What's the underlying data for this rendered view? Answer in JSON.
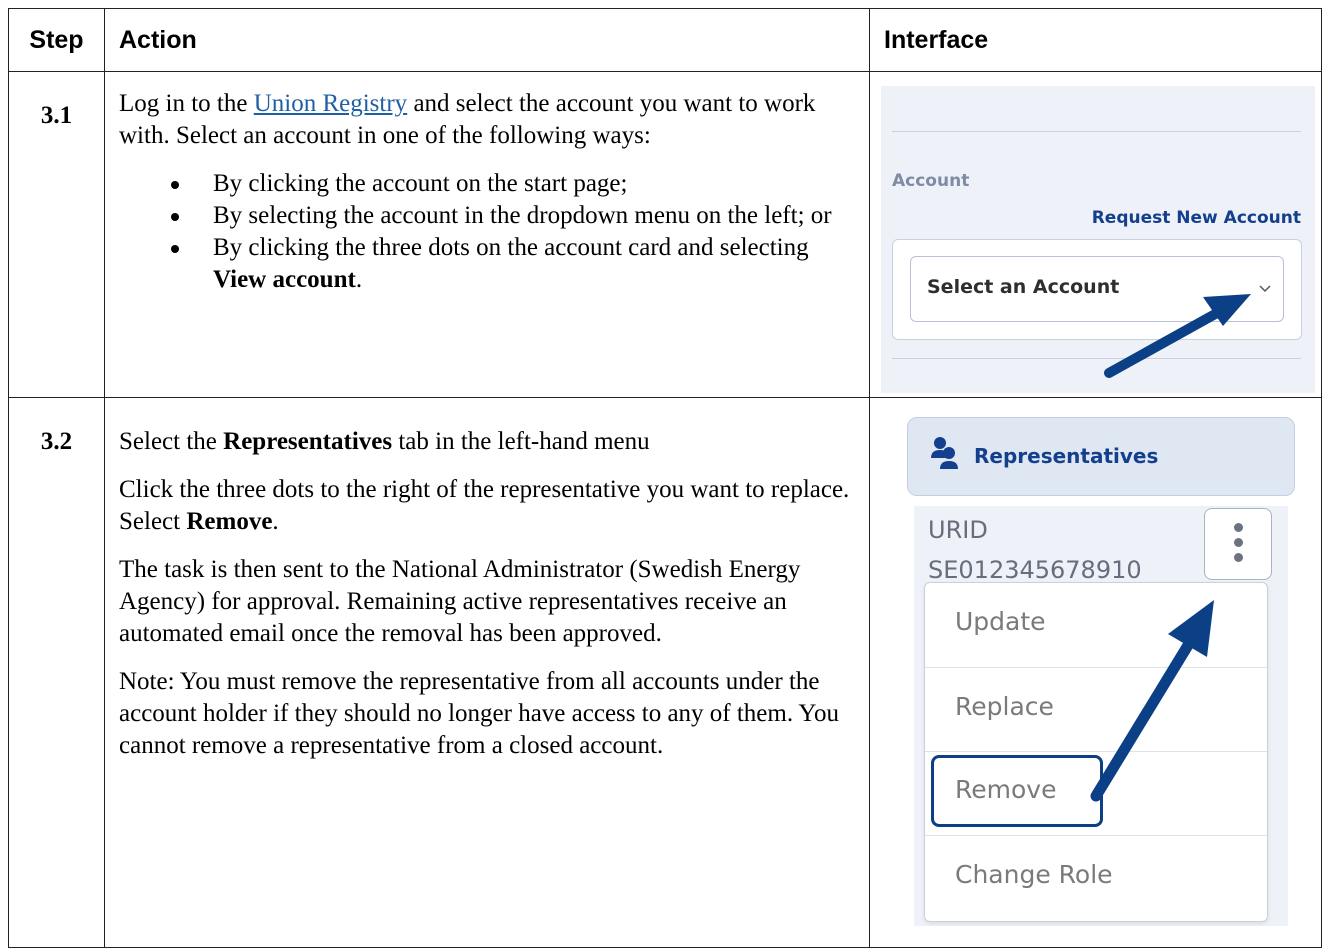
{
  "headers": {
    "step": "Step",
    "action": "Action",
    "interface": "Interface"
  },
  "rows": [
    {
      "step": "3.1",
      "intro_1": "Log in to the ",
      "link": "Union Registry",
      "intro_2": " and select the account you want to work with. Select an account in one of the following ways:",
      "bullets": [
        "By clicking the account on the start page;",
        "By selecting the account in the dropdown menu on the left; or"
      ],
      "bullet3_pre": "By clicking the three dots on the account card and selecting ",
      "bullet3_bold": "View account",
      "bullet3_post": "."
    },
    {
      "step": "3.2",
      "p1_pre": "Select the ",
      "p1_bold": "Representatives",
      "p1_post": " tab in the left-hand menu",
      "p2_pre": "Click the three dots to the right of the representative you want to replace. Select ",
      "p2_bold": "Remove",
      "p2_post": ".",
      "p3": "The task is then sent to the National Administrator (Swedish Energy Agency) for approval. Remaining active representatives receive an automated email once the removal has been approved.",
      "p4": "Note: You must remove the representative from all accounts under the account holder if they should no longer have access to any of them. You cannot remove a representative from a closed account."
    }
  ],
  "panel1": {
    "account_label": "Account",
    "request_link": "Request New Account",
    "select_placeholder": "Select an Account",
    "chevron_icon": "chevron-down-icon"
  },
  "panel2": {
    "tab_label": "Representatives",
    "tab_icon": "users-icon",
    "urid_label": "URID",
    "urid_value": "SE012345678910",
    "menu": [
      "Update",
      "Replace",
      "Remove",
      "Change Role"
    ],
    "arrow_color": "#0b3f86"
  }
}
